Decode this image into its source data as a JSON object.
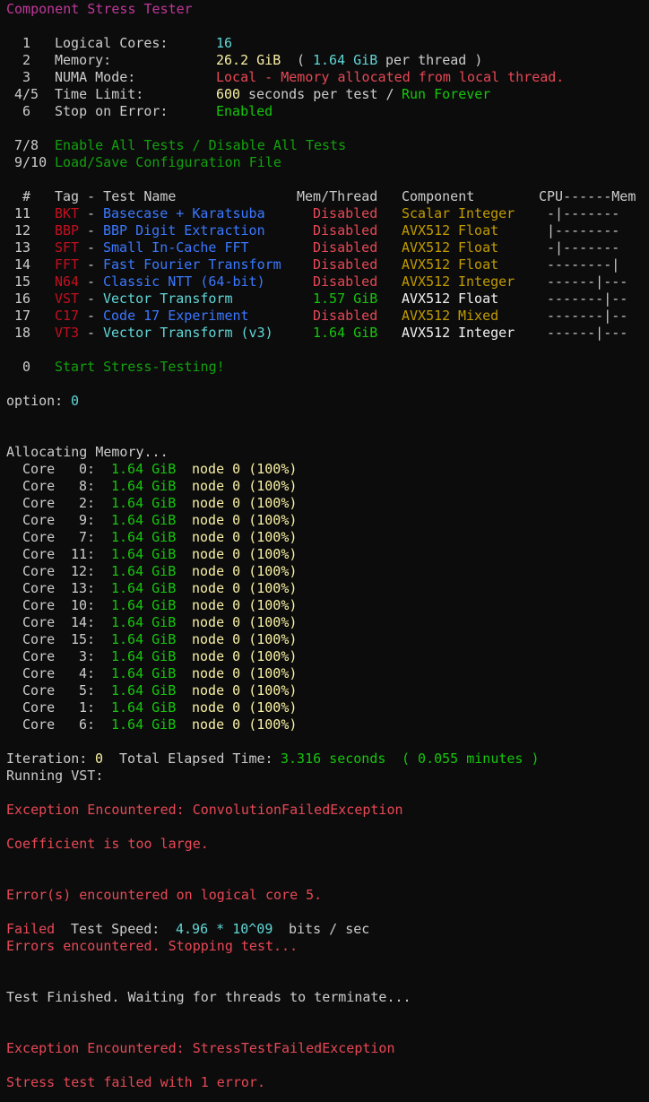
{
  "title": "Component Stress Tester",
  "settings": [
    {
      "num": "1",
      "label": "Logical Cores:",
      "value": "16"
    },
    {
      "num": "2",
      "label": "Memory:",
      "value": "26.2 GiB",
      "paren_open": "(",
      "per_thread": "1.64 GiB",
      "per_thread_suffix": "per thread )"
    },
    {
      "num": "3",
      "label": "NUMA Mode:",
      "value": "Local - Memory allocated from local thread."
    },
    {
      "num": "4/5",
      "label": "Time Limit:",
      "value": "600",
      "value_suffix": "seconds per test /",
      "alt": "Run Forever"
    },
    {
      "num": "6",
      "label": "Stop on Error:",
      "value": "Enabled"
    }
  ],
  "actions": [
    {
      "num": "7/8",
      "label": "Enable All Tests / Disable All Tests"
    },
    {
      "num": "9/10",
      "label": "Load/Save Configuration File"
    }
  ],
  "table_header": {
    "num": "#",
    "tag": "Tag - Test Name",
    "mem": "Mem/Thread",
    "component": "Component",
    "cpu_mem": "CPU------Mem"
  },
  "tests": [
    {
      "num": "11",
      "tag": "BKT",
      "name": "Basecase + Karatsuba",
      "mem": "Disabled",
      "enabled": false,
      "comp_a": "Scalar",
      "comp_b": "Integer",
      "bar": "-|-------"
    },
    {
      "num": "12",
      "tag": "BBP",
      "name": "BBP Digit Extraction",
      "mem": "Disabled",
      "enabled": false,
      "comp_a": "AVX512",
      "comp_b": "Float",
      "bar": "|--------"
    },
    {
      "num": "13",
      "tag": "SFT",
      "name": "Small In-Cache FFT",
      "mem": "Disabled",
      "enabled": false,
      "comp_a": "AVX512",
      "comp_b": "Float",
      "bar": "-|-------"
    },
    {
      "num": "14",
      "tag": "FFT",
      "name": "Fast Fourier Transform",
      "mem": "Disabled",
      "enabled": false,
      "comp_a": "AVX512",
      "comp_b": "Float",
      "bar": "--------|"
    },
    {
      "num": "15",
      "tag": "N64",
      "name": "Classic NTT (64-bit)",
      "mem": "Disabled",
      "enabled": false,
      "comp_a": "AVX512",
      "comp_b": "Integer",
      "bar": "------|---"
    },
    {
      "num": "16",
      "tag": "VST",
      "name": "Vector Transform",
      "mem": "1.57 GiB",
      "enabled": true,
      "comp_a": "AVX512",
      "comp_b": "Float",
      "bar": "-------|--"
    },
    {
      "num": "17",
      "tag": "C17",
      "name": "Code 17 Experiment",
      "mem": "Disabled",
      "enabled": false,
      "comp_a": "AVX512",
      "comp_b": "Mixed",
      "bar": "-------|--"
    },
    {
      "num": "18",
      "tag": "VT3",
      "name": "Vector Transform (v3)",
      "mem": "1.64 GiB",
      "enabled": true,
      "comp_a": "AVX512",
      "comp_b": "Integer",
      "bar": "------|---"
    }
  ],
  "start": {
    "num": "0",
    "label": "Start Stress-Testing!"
  },
  "prompt": {
    "label": "option:",
    "value": "0"
  },
  "allocating": "Allocating Memory...",
  "cores": [
    {
      "core": "0",
      "mem": "1.64 GiB",
      "node": "node 0 (100%)"
    },
    {
      "core": "8",
      "mem": "1.64 GiB",
      "node": "node 0 (100%)"
    },
    {
      "core": "2",
      "mem": "1.64 GiB",
      "node": "node 0 (100%)"
    },
    {
      "core": "9",
      "mem": "1.64 GiB",
      "node": "node 0 (100%)"
    },
    {
      "core": "7",
      "mem": "1.64 GiB",
      "node": "node 0 (100%)"
    },
    {
      "core": "11",
      "mem": "1.64 GiB",
      "node": "node 0 (100%)"
    },
    {
      "core": "12",
      "mem": "1.64 GiB",
      "node": "node 0 (100%)"
    },
    {
      "core": "13",
      "mem": "1.64 GiB",
      "node": "node 0 (100%)"
    },
    {
      "core": "10",
      "mem": "1.64 GiB",
      "node": "node 0 (100%)"
    },
    {
      "core": "14",
      "mem": "1.64 GiB",
      "node": "node 0 (100%)"
    },
    {
      "core": "15",
      "mem": "1.64 GiB",
      "node": "node 0 (100%)"
    },
    {
      "core": "3",
      "mem": "1.64 GiB",
      "node": "node 0 (100%)"
    },
    {
      "core": "4",
      "mem": "1.64 GiB",
      "node": "node 0 (100%)"
    },
    {
      "core": "5",
      "mem": "1.64 GiB",
      "node": "node 0 (100%)"
    },
    {
      "core": "1",
      "mem": "1.64 GiB",
      "node": "node 0 (100%)"
    },
    {
      "core": "6",
      "mem": "1.64 GiB",
      "node": "node 0 (100%)"
    }
  ],
  "core_label": "Core",
  "iteration": {
    "label": "Iteration:",
    "value": "0",
    "elapsed_label": "Total Elapsed Time:",
    "elapsed": "3.316 seconds",
    "minutes": "( 0.055 minutes )"
  },
  "running": "Running VST:",
  "exception1": "Exception Encountered: ConvolutionFailedException",
  "coefficient": "Coefficient is too large.",
  "core_error": "Error(s) encountered on logical core 5.",
  "failed": {
    "label": "Failed",
    "speed_label": "Test Speed:",
    "speed": "4.96 * 10^09",
    "unit": "bits / sec"
  },
  "stopping": "Errors encountered. Stopping test...",
  "finished": "Test Finished. Waiting for threads to terminate...",
  "exception2": "Exception Encountered: StressTestFailedException",
  "final": "Stress test failed with 1 error."
}
